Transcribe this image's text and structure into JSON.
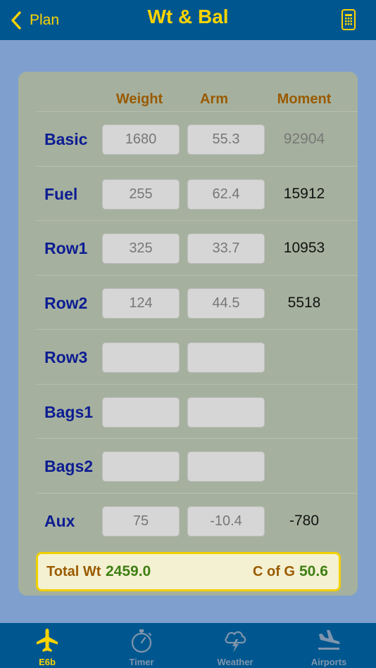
{
  "nav": {
    "back_label": "Plan",
    "title": "Wt & Bal",
    "right_icon": "phone-icon"
  },
  "columns": {
    "weight": "Weight",
    "arm": "Arm",
    "moment": "Moment"
  },
  "rows": [
    {
      "label": "Basic",
      "weight": "1680",
      "arm": "55.3",
      "moment": "92904"
    },
    {
      "label": "Fuel",
      "weight": "255",
      "arm": "62.4",
      "moment": "15912"
    },
    {
      "label": "Row1",
      "weight": "325",
      "arm": "33.7",
      "moment": "10953"
    },
    {
      "label": "Row2",
      "weight": "124",
      "arm": "44.5",
      "moment": "5518"
    },
    {
      "label": "Row3",
      "weight": "",
      "arm": "",
      "moment": ""
    },
    {
      "label": "Bags1",
      "weight": "",
      "arm": "",
      "moment": ""
    },
    {
      "label": "Bags2",
      "weight": "",
      "arm": "",
      "moment": ""
    },
    {
      "label": "Aux",
      "weight": "75",
      "arm": "-10.4",
      "moment": "-780"
    }
  ],
  "totals": {
    "weight_label": "Total Wt",
    "weight_value": "2459.0",
    "cg_label": "C of G",
    "cg_value": "50.6"
  },
  "tabs": [
    {
      "label": "E6b",
      "icon": "airplane-icon",
      "active": true
    },
    {
      "label": "Timer",
      "icon": "stopwatch-icon",
      "active": false
    },
    {
      "label": "Weather",
      "icon": "storm-cloud-icon",
      "active": false
    },
    {
      "label": "Airports",
      "icon": "plane-landing-icon",
      "active": false
    }
  ],
  "colors": {
    "nav_bg": "#00578f",
    "accent_yellow": "#ffd400",
    "panel_bg": "#a5b19e",
    "page_bg": "#7f9fcf",
    "label_blue": "#0d1c92",
    "header_brown": "#9a5a00",
    "total_green": "#3f7f14"
  }
}
